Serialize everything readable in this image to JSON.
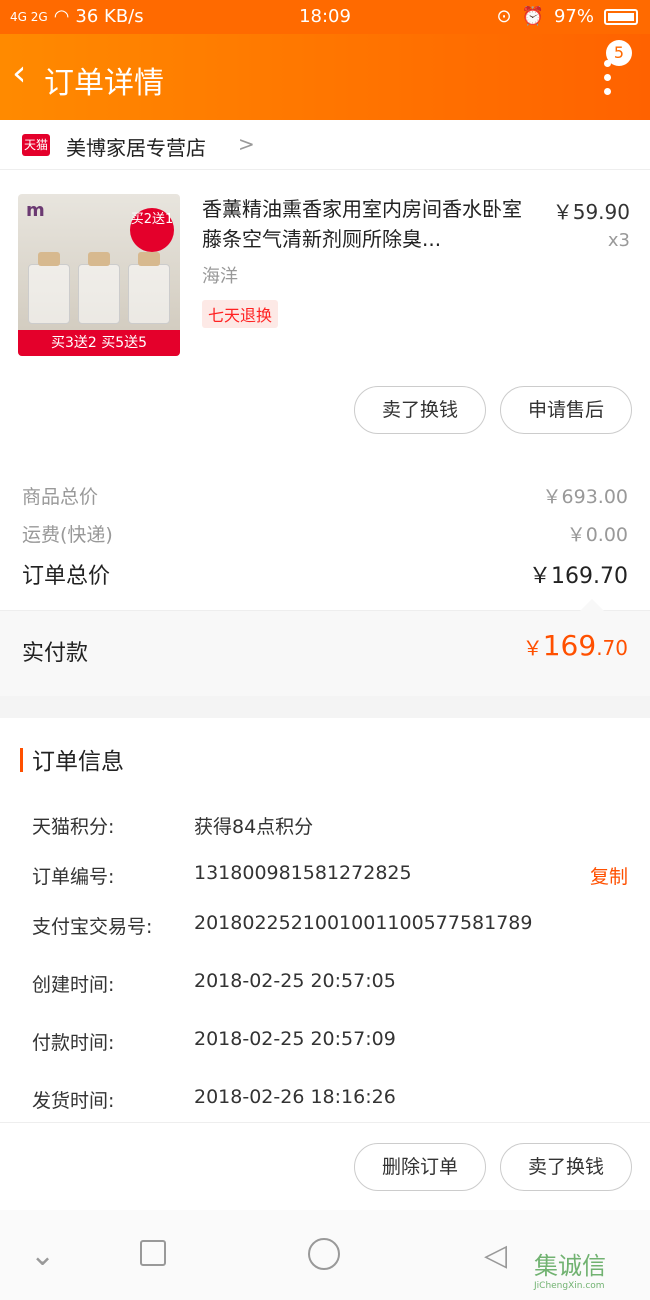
{
  "status_bar": {
    "signal": "4G 2G",
    "speed": "36 KB/s",
    "time": "18:09",
    "battery": "97%"
  },
  "nav": {
    "back_icon": "chevron-left",
    "title": "订单详情",
    "badge": "5"
  },
  "shop": {
    "platform": "天猫",
    "name": "美博家居专营店",
    "chevron": ">"
  },
  "product": {
    "title": "香薰精油熏香家用室内房间香水卧室藤条空气清新剂厕所除臭...",
    "price": "￥59.90",
    "qty": "x3",
    "variant": "海洋",
    "tag": "七天退换",
    "image_brand": "m",
    "image_burst": "买2送1",
    "image_strip": "买3送2 买5送5"
  },
  "product_actions": {
    "sell": "卖了换钱",
    "after_sale": "申请售后"
  },
  "totals": {
    "goods_label": "商品总价",
    "goods_value": "￥693.00",
    "shipping_label": "运费(快递)",
    "shipping_value": "￥0.00",
    "order_label": "订单总价",
    "order_value": "￥169.70"
  },
  "paid": {
    "label": "实付款",
    "symbol": "￥",
    "int": "169",
    "dec": ".70"
  },
  "order_info": {
    "title": "订单信息",
    "rows": [
      {
        "label": "天猫积分:",
        "value": "获得84点积分"
      },
      {
        "label": "订单编号:",
        "value": "131800981581272825"
      },
      {
        "label": "支付宝交易号:",
        "value": "2018022521001001100577581789"
      },
      {
        "label": "创建时间:",
        "value": "2018-02-25 20:57:05"
      },
      {
        "label": "付款时间:",
        "value": "2018-02-25 20:57:09"
      },
      {
        "label": "发货时间:",
        "value": "2018-02-26 18:16:26"
      }
    ],
    "copy": "复制"
  },
  "bottom_actions": {
    "delete": "删除订单",
    "sell": "卖了换钱"
  },
  "watermark": {
    "text": "集诚信",
    "sub": "JiChengXin.com"
  },
  "colors": {
    "accent": "#ff6a00",
    "price": "#ff5000"
  }
}
